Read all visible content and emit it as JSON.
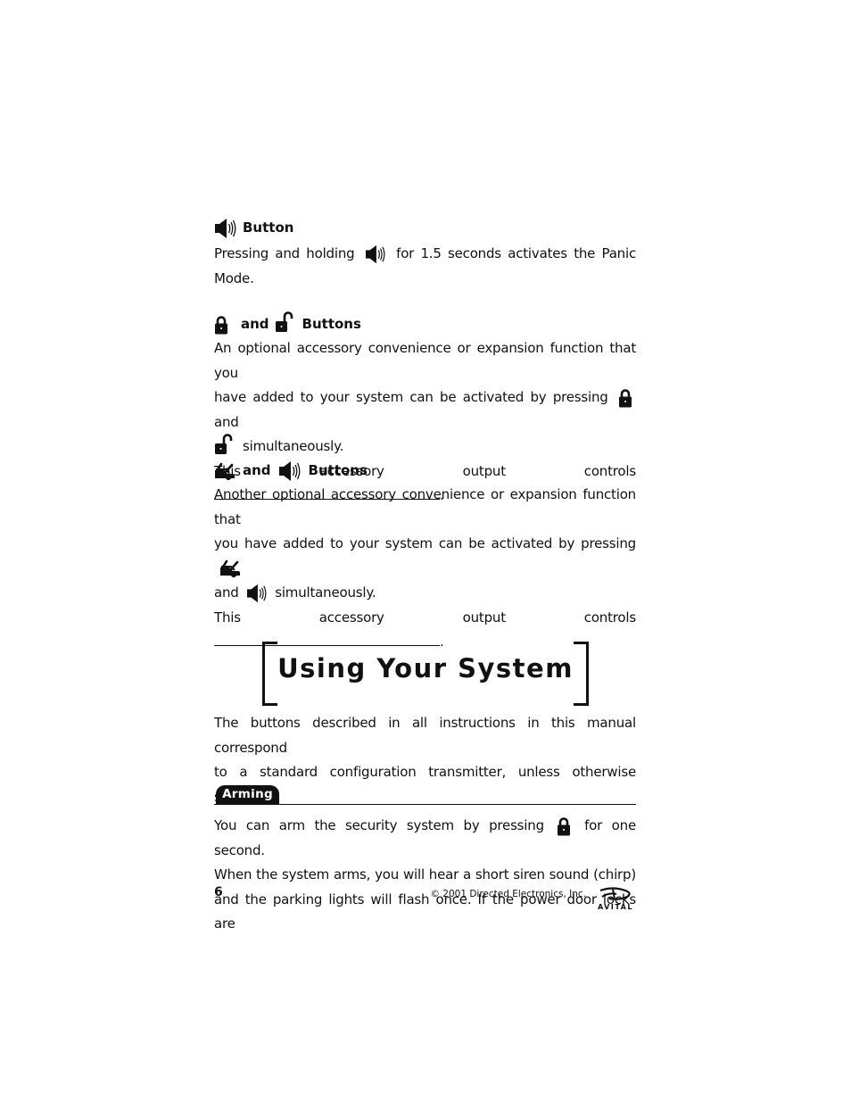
{
  "sections": {
    "panic": {
      "heading_label": "Button",
      "body_before_icon": "Pressing and holding",
      "body_after_icon": "for 1.5 seconds activates the Panic",
      "body_line2": "Mode.",
      "icons": [
        "speaker-icon"
      ]
    },
    "lock_unlock": {
      "heading_and": "and",
      "heading_label": "Buttons",
      "body_line1": "An optional accessory convenience or expansion function that you",
      "body_line2_before": "have added to your system can be activated by pressing",
      "body_line2_after": "and",
      "body_line3_after": "simultaneously.",
      "output_label": "This accessory output controls",
      "output_end": ".",
      "icons": [
        "lock-icon",
        "unlock-icon"
      ]
    },
    "trunk_panic": {
      "heading_and": "and",
      "heading_label": "Buttons",
      "body_line1": "Another optional accessory convenience or expansion function that",
      "body_line2_before": "you have added to your system can be activated by pressing",
      "body_line3_before": "and",
      "body_line3_after": "simultaneously.",
      "output_label": "This accessory output controls",
      "output_end": ".",
      "icons": [
        "trunk-icon",
        "speaker-icon"
      ]
    }
  },
  "chapter": {
    "title": "Using Your System",
    "intro_line1": "The buttons described in all instructions in this manual correspond",
    "intro_line2": "to a standard configuration transmitter, unless otherwise specified."
  },
  "arming": {
    "tab_label": "Arming",
    "line1_before": "You can arm the security system by pressing",
    "line1_after": "for one second.",
    "line2": "When the system arms, you will hear a short siren sound (chirp)",
    "line3": "and the parking lights will flash once. If the power door locks are"
  },
  "footer": {
    "page_number": "6",
    "copyright": "© 2001 Directed Electronics, Inc.",
    "logo_text": "AVITAL"
  }
}
